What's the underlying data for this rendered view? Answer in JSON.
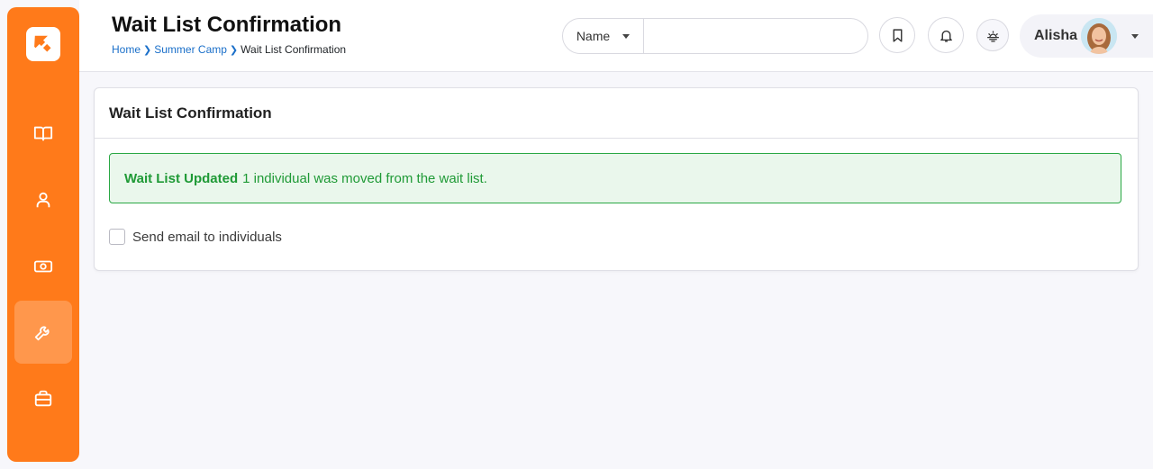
{
  "sidebar": {
    "logo": "logo-icon",
    "items": [
      {
        "name": "book",
        "icon": "book-icon",
        "active": false
      },
      {
        "name": "person",
        "icon": "person-icon",
        "active": false
      },
      {
        "name": "money",
        "icon": "money-icon",
        "active": false
      },
      {
        "name": "tools",
        "icon": "wrench-icon",
        "active": true
      },
      {
        "name": "briefcase",
        "icon": "briefcase-icon",
        "active": false
      }
    ],
    "color": "#ff7a1a"
  },
  "header": {
    "title": "Wait List Confirmation",
    "breadcrumb": {
      "home": "Home",
      "parent": "Summer Camp",
      "current": "Wait List Confirmation"
    },
    "search": {
      "field_select": "Name",
      "placeholder": ""
    },
    "buttons": [
      "bookmark-icon",
      "bell-icon",
      "sunrise-icon"
    ],
    "user": {
      "name": "Alisha"
    }
  },
  "card": {
    "title": "Wait List Confirmation",
    "alert": {
      "heading": "Wait List Updated",
      "message": "1 individual was moved from the wait list.",
      "color": "#1f9a36"
    },
    "checkbox": {
      "label": "Send email to individuals",
      "checked": false
    }
  }
}
